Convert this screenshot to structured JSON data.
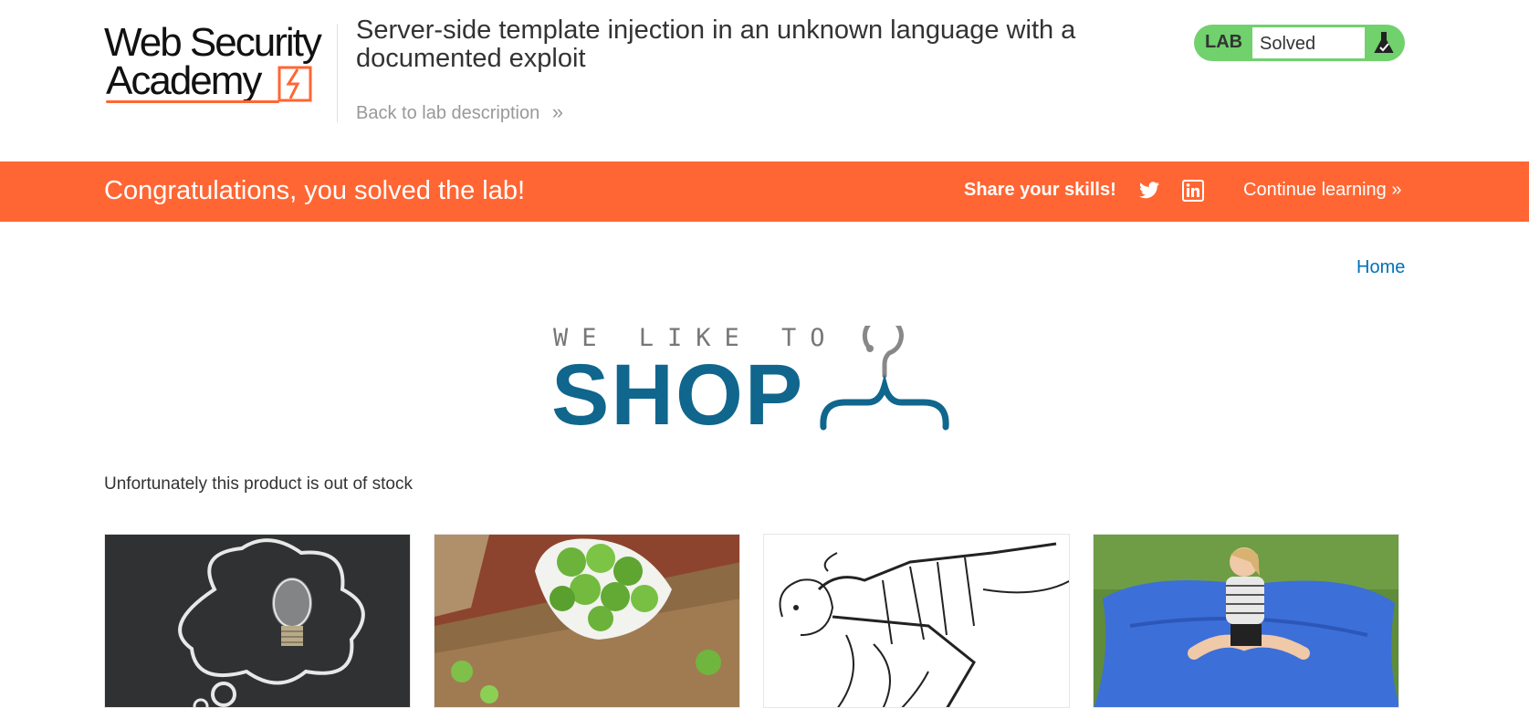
{
  "brand": {
    "line1": "Web Security",
    "line2": "Academy"
  },
  "lab": {
    "title": "Server-side template injection in an unknown language with a documented exploit",
    "back_link": "Back to lab description",
    "status_tag": "LAB",
    "status": "Solved"
  },
  "banner": {
    "message": "Congratulations, you solved the lab!",
    "share_label": "Share your skills!",
    "continue_label": "Continue learning"
  },
  "nav": {
    "home": "Home"
  },
  "shop_logo": {
    "tagline": "WE LIKE TO",
    "word": "SHOP"
  },
  "stock_message": "Unfortunately this product is out of stock",
  "colors": {
    "accent_orange": "#ff6633",
    "solved_green": "#70d16d",
    "link_blue": "#0071bc",
    "shop_blue": "#10668d"
  },
  "icons": {
    "back": "double-chevron-right-icon",
    "status": "flask-icon",
    "share1": "twitter-icon",
    "share2": "linkedin-icon",
    "continue": "double-chevron-right-icon",
    "logo": "hanger-icon"
  }
}
